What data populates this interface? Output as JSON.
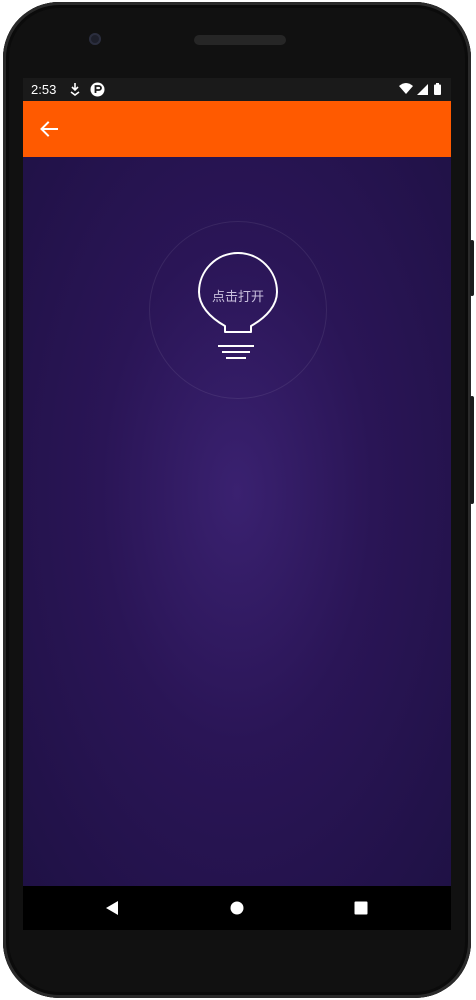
{
  "status_bar": {
    "time": "2:53",
    "icons": [
      "download-icon",
      "app-notification-icon",
      "wifi-icon",
      "signal-icon",
      "battery-icon"
    ]
  },
  "app_bar": {
    "back_icon": "arrow-back-icon",
    "color": "#ff5a00"
  },
  "main": {
    "bulb_label": "点击打开",
    "background_color": "#2a1556"
  },
  "nav_bar": {
    "icons": [
      "back-triangle-icon",
      "home-circle-icon",
      "recents-square-icon"
    ]
  }
}
